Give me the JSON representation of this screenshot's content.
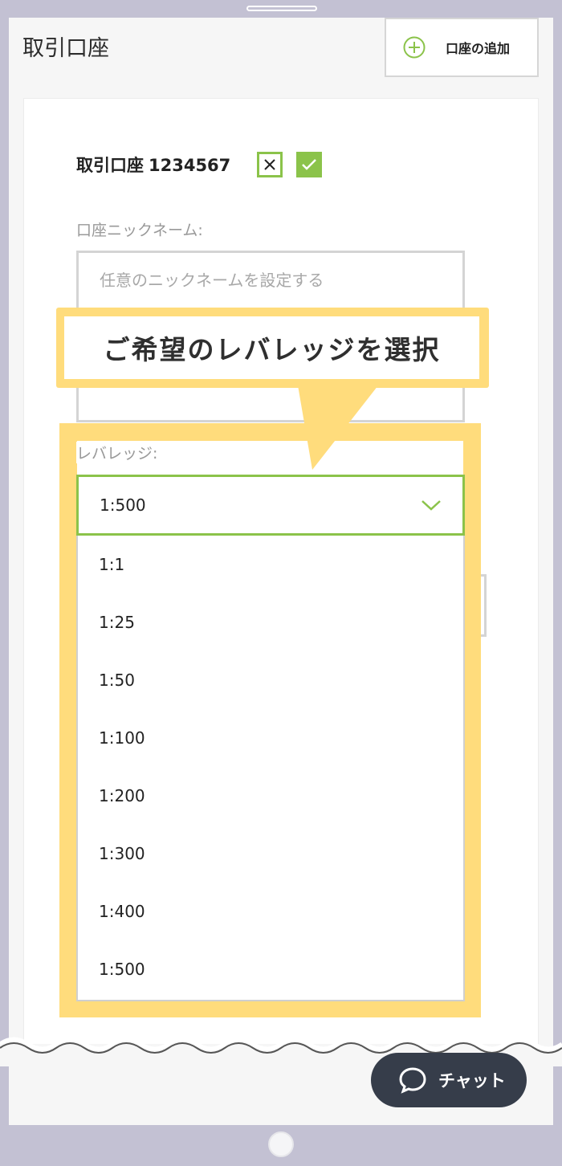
{
  "header": {
    "title": "取引口座",
    "add_account_label": "口座の追加"
  },
  "account": {
    "title_prefix": "取引口座",
    "number": "1234567"
  },
  "nickname": {
    "label": "口座ニックネーム:",
    "placeholder": "任意のニックネームを設定する"
  },
  "callout": {
    "text": "ご希望のレバレッジを選択"
  },
  "leverage": {
    "label": "レバレッジ:",
    "selected": "1:500",
    "options": [
      "1:1",
      "1:25",
      "1:50",
      "1:100",
      "1:200",
      "1:300",
      "1:400",
      "1:500"
    ]
  },
  "chat": {
    "label": "チャット"
  },
  "colors": {
    "accent": "#8bc34a",
    "highlight": "#ffdc7c",
    "chat_bg": "#363d4a",
    "frame": "#c3c1d3"
  }
}
